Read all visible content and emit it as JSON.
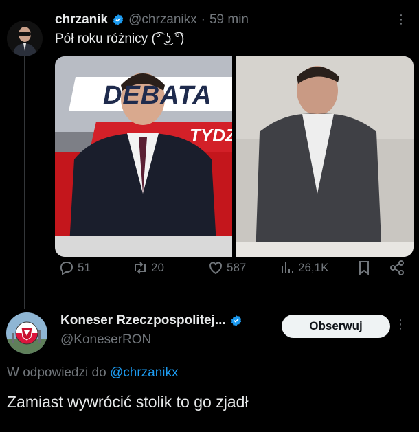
{
  "tweet": {
    "author_name": "chrzanik",
    "author_handle": "@chrzanikx",
    "separator": "·",
    "time": "59 min",
    "text": "Pół roku różnicy (͡° ͜ʖ ͡°)",
    "more_icon": "more-vertical-icon",
    "media": {
      "left_banner_text": "DEBATA",
      "left_banner_sub": "TYDZ"
    },
    "actions": {
      "replies": "51",
      "retweets": "20",
      "likes": "587",
      "views": "26,1K"
    }
  },
  "reply": {
    "author_name": "Koneser Rzeczpospolitej...",
    "author_handle": "@KoneserRON",
    "follow_label": "Obserwuj",
    "reply_to_prefix": "W odpowiedzi do",
    "reply_to_mention": "@chrzanikx",
    "text": "Zamiast wywrócić stolik to go zjadł"
  },
  "colors": {
    "background": "#000000",
    "text_primary": "#e7e9ea",
    "text_secondary": "#71767b",
    "accent": "#1d9bf0",
    "thread_line": "#333639"
  }
}
